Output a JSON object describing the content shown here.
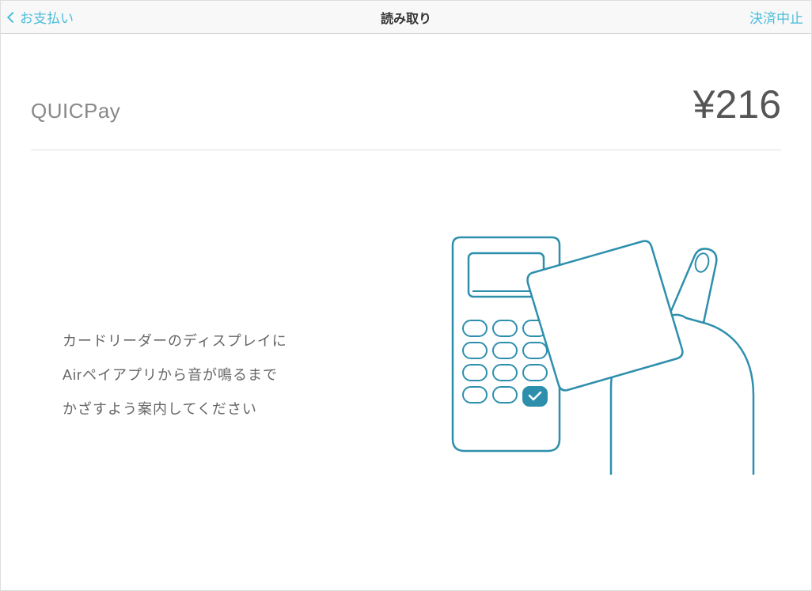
{
  "header": {
    "back_label": "お支払い",
    "title": "読み取り",
    "cancel_label": "決済中止"
  },
  "payment": {
    "method": "QUICPay",
    "amount": "¥216"
  },
  "instructions": {
    "line1": "カードリーダーのディスプレイに",
    "line2": "Airペイアプリから音が鳴るまで",
    "line3": "かざすよう案内してください"
  }
}
